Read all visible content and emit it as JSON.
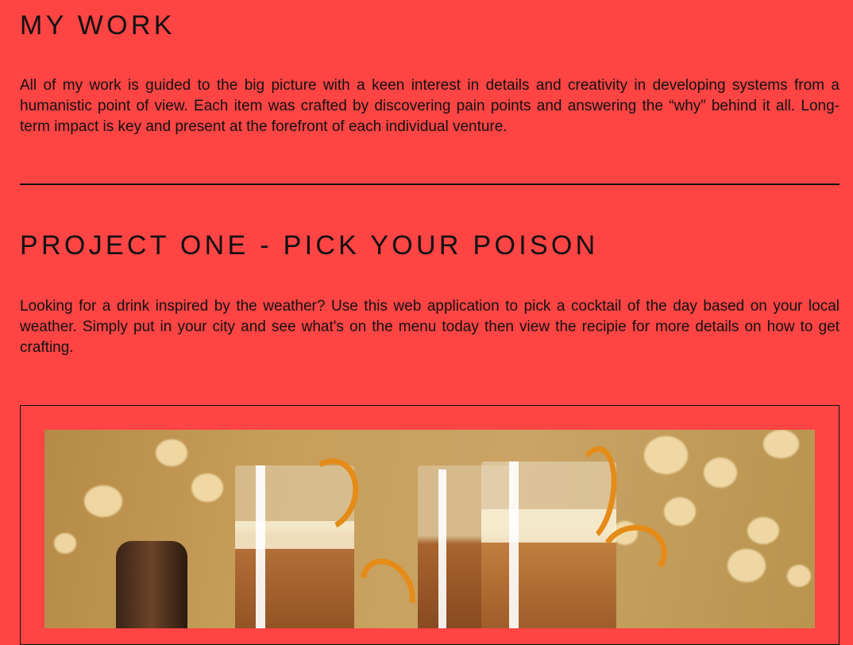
{
  "my_work": {
    "title": "MY WORK",
    "intro": "All of my work is guided to the big picture with a keen interest in details and creativity in developing systems from a humanistic point of view. Each item was crafted by discovering pain points and answering the “why” behind it all. Long-term impact is key and present at the forefront of each individual venture."
  },
  "project": {
    "title": "PROJECT ONE - PICK YOUR POISON",
    "description": "Looking for a drink inspired by the weather? Use this web application to pick a cocktail of the day based on your local weather. Simply put in your city and see what's on the menu today then view the recipie for more details on how to get crafting."
  }
}
